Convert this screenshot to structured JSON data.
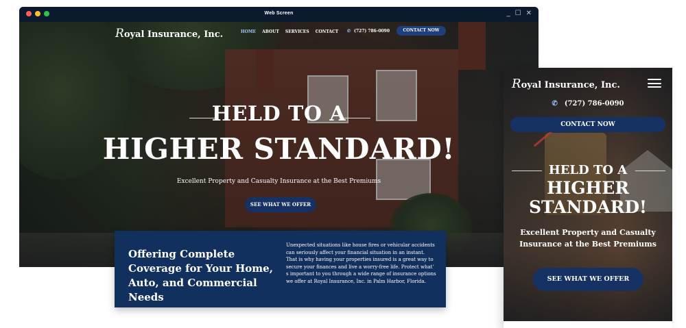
{
  "window": {
    "title": "Web Screen",
    "controls": [
      "_",
      "☐",
      "✕"
    ]
  },
  "brand": {
    "logo_initial": "R",
    "logo_rest": "oyal Insurance, Inc."
  },
  "nav": {
    "items": [
      "HOME",
      "ABOUT",
      "SERVICES",
      "CONTACT"
    ],
    "active": "HOME",
    "phone": "(727) 786-0090",
    "contact_button": "CONTACT NOW"
  },
  "hero": {
    "heading_small": "HELD TO A",
    "heading_big": "HIGHER STANDARD!",
    "subheading": "Excellent Property and Casualty Insurance at the Best Premiums",
    "cta": "SEE WHAT WE OFFER"
  },
  "coverage": {
    "title": "Offering Complete Coverage for Your Home, Auto, and Commercial Needs",
    "text": "Unexpected situations like house fires or vehicular accidents can seriously affect your financial situation in an instant. That is why having your properties insured is a great way to secure your finances and live a worry-free life. Protect what’ s important to you through a wide range of insurance options we offer at Royal Insurance, Inc. in Palm Harbor, Florida."
  },
  "mobile": {
    "logo_initial": "R",
    "logo_rest": "oyal Insurance, Inc.",
    "phone": "(727) 786-0090",
    "contact_button": "CONTACT NOW",
    "heading_small": "HELD TO A",
    "heading_big_1": "HIGHER",
    "heading_big_2": "STANDARD!",
    "subheading": "Excellent Property and Casualty Insurance at the Best Premiums",
    "cta": "SEE WHAT WE OFFER"
  },
  "icons": {
    "phone": "phone-icon",
    "menu": "hamburger-menu-icon"
  },
  "colors": {
    "navy": "#12305e",
    "button": "#163264",
    "titlebar": "#0b1a2e"
  }
}
